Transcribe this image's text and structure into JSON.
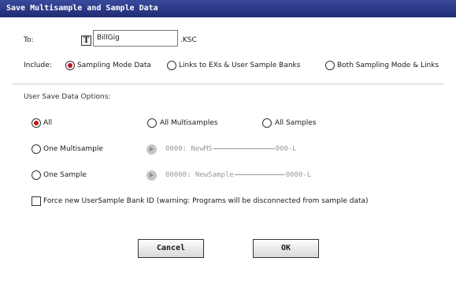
{
  "dialog": {
    "title": "Save Multisample and Sample Data"
  },
  "to": {
    "label": "To:",
    "text_button": "T",
    "filename": "BillGig",
    "extension": ".KSC"
  },
  "include": {
    "label": "Include:",
    "options": [
      {
        "label": "Sampling Mode Data",
        "selected": true
      },
      {
        "label": "Links to EXs & User Sample Banks",
        "selected": false
      },
      {
        "label": "Both Sampling Mode & Links",
        "selected": false
      }
    ]
  },
  "user_save": {
    "heading": "User Save Data Options:",
    "all": {
      "label": "All",
      "selected": true
    },
    "all_multisamples": {
      "label": "All Multisamples",
      "selected": false
    },
    "all_samples": {
      "label": "All Samples",
      "selected": false
    },
    "one_multisample": {
      "label": "One Multisample",
      "selected": false,
      "value_prefix": "0000: NewMS",
      "value_suffix": "000-L"
    },
    "one_sample": {
      "label": "One Sample",
      "selected": false,
      "value_prefix": "00000: NewSample",
      "value_suffix": "0000-L"
    }
  },
  "force_new": {
    "label": "Force new UserSample Bank ID (warning: Programs will be disconnected from sample data)",
    "checked": false
  },
  "buttons": {
    "cancel": "Cancel",
    "ok": "OK"
  },
  "colors": {
    "title_bar": "#1e2c74",
    "radio_selected": "#c0141c"
  }
}
